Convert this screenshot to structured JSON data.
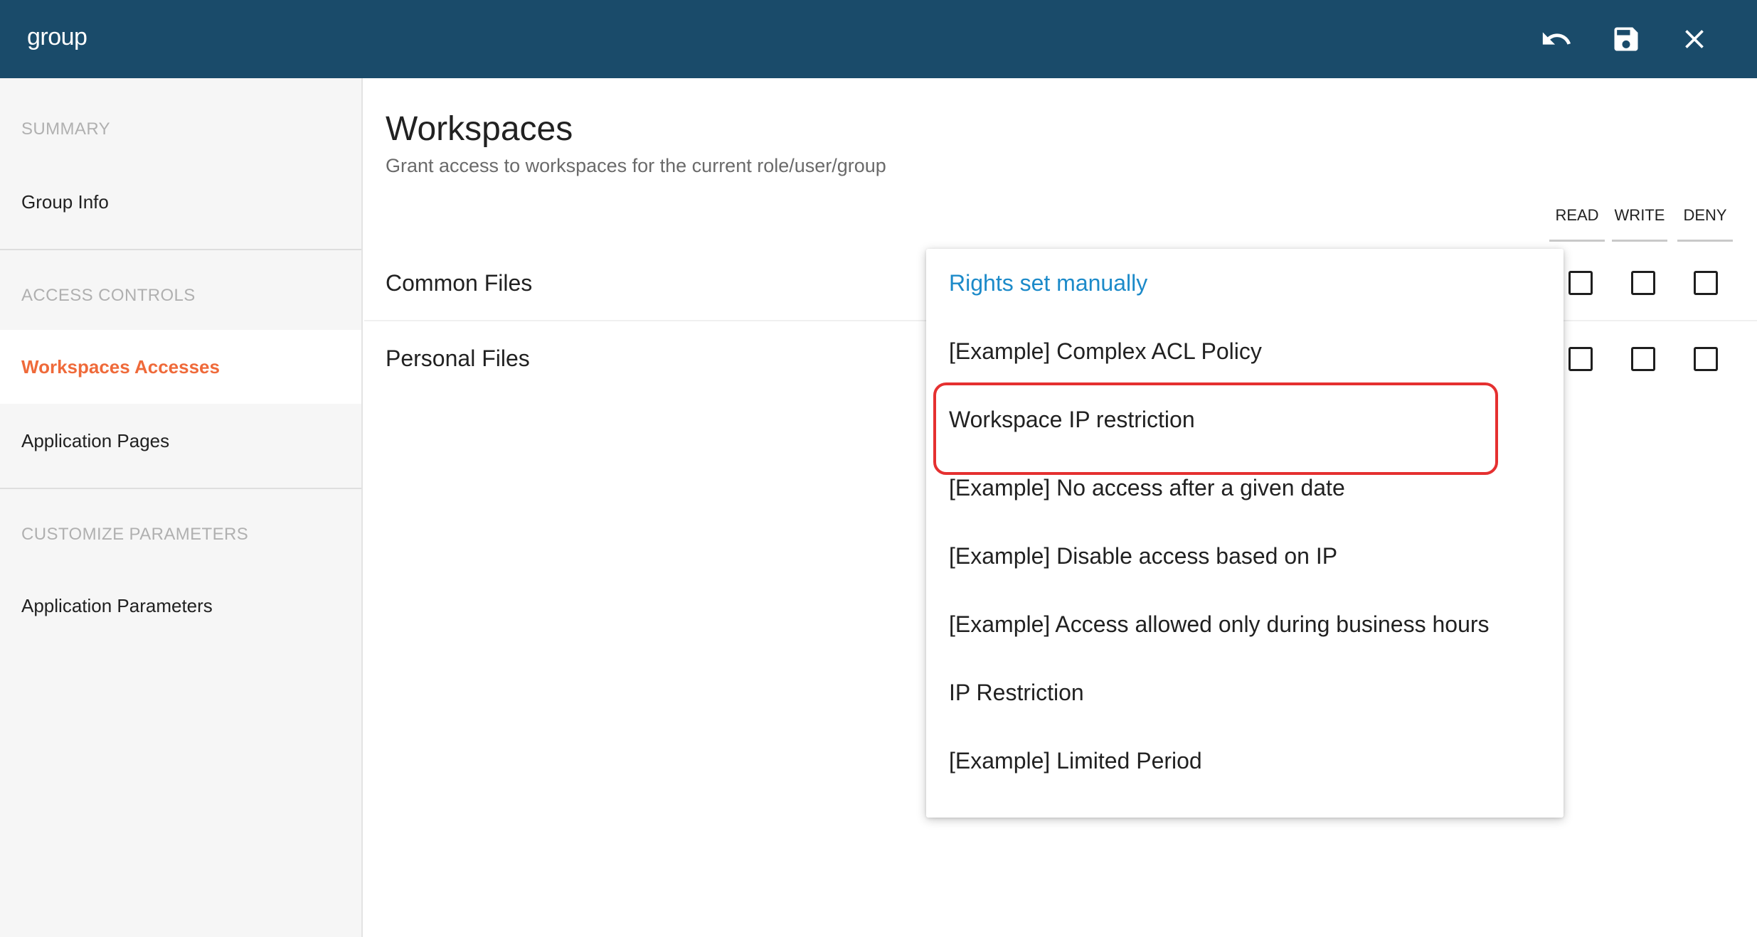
{
  "header": {
    "title": "group",
    "undo_icon": "undo-icon",
    "save_icon": "save-icon",
    "close_icon": "close-icon"
  },
  "sidebar": {
    "sections": [
      {
        "label": "SUMMARY",
        "items": [
          {
            "label": "Group Info",
            "active": false
          }
        ]
      },
      {
        "label": "ACCESS CONTROLS",
        "items": [
          {
            "label": "Workspaces Accesses",
            "active": true
          },
          {
            "label": "Application Pages",
            "active": false
          }
        ]
      },
      {
        "label": "CUSTOMIZE PARAMETERS",
        "items": [
          {
            "label": "Application Parameters",
            "active": false
          }
        ]
      }
    ]
  },
  "main": {
    "title": "Workspaces",
    "subtitle": "Grant access to workspaces for the current role/user/group",
    "columns": [
      "READ",
      "WRITE",
      "DENY"
    ],
    "workspaces": [
      {
        "name": "Common Files",
        "read": false,
        "write": false,
        "deny": false
      },
      {
        "name": "Personal Files",
        "read": false,
        "write": false,
        "deny": false
      }
    ]
  },
  "dropdown": {
    "selected_index": 0,
    "highlighted_index": 2,
    "options": [
      "Rights set manually",
      "[Example] Complex ACL Policy",
      "Workspace IP restriction",
      "[Example] No access after a given date",
      "[Example] Disable access based on IP",
      "[Example] Access allowed only during business hours",
      "IP Restriction",
      "[Example] Limited Period"
    ]
  },
  "colors": {
    "header_bg": "#1a4b6a",
    "active_nav": "#ef6a3a",
    "selected_option": "#1c8ac9",
    "highlight_border": "#e53030"
  }
}
